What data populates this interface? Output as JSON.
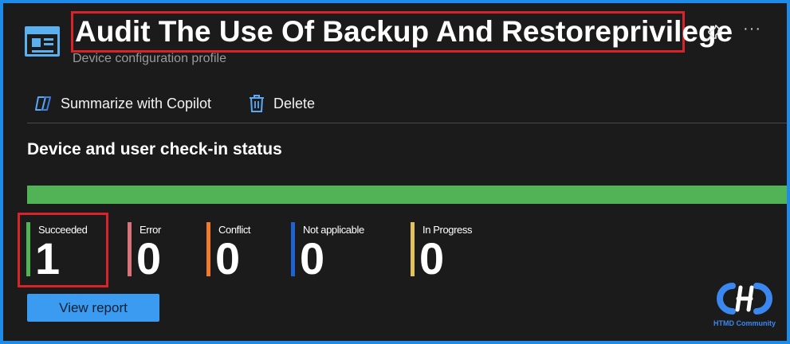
{
  "header": {
    "title": "Audit The Use Of Backup And Restoreprivilege",
    "subtitle": "Device configuration profile",
    "page_icon": "profile-window-icon",
    "pin_icon": "pin-icon",
    "more_icon": "more-icon",
    "more_label": "···"
  },
  "toolbar": {
    "summarize_label": "Summarize with Copilot",
    "summarize_icon": "copilot-icon",
    "delete_label": "Delete",
    "delete_icon": "trash-icon"
  },
  "section": {
    "title": "Device and user check-in status"
  },
  "status_bar": {
    "succeeded_fraction": 1.0,
    "color": "#52b356"
  },
  "stats": [
    {
      "label": "Succeeded",
      "value": "1",
      "color": "#52b356"
    },
    {
      "label": "Error",
      "value": "0",
      "color": "#d9737a"
    },
    {
      "label": "Conflict",
      "value": "0",
      "color": "#f07c2a"
    },
    {
      "label": "Not applicable",
      "value": "0",
      "color": "#1d63d4"
    },
    {
      "label": "In Progress",
      "value": "0",
      "color": "#e0c35a"
    }
  ],
  "actions": {
    "view_report_label": "View report"
  },
  "watermark": {
    "text": "HTMD Community"
  },
  "colors": {
    "accent": "#3b9bf0",
    "highlight": "#d8232a"
  }
}
